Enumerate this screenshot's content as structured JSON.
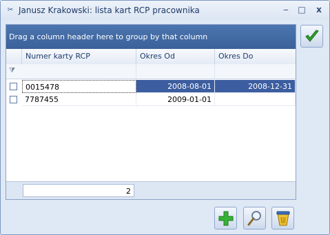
{
  "window": {
    "title": "Janusz Krakowski: lista kart RCP pracownika",
    "min_glyph": "‒",
    "max_glyph": "□",
    "close_glyph": "x"
  },
  "grid": {
    "group_panel_text": "Drag a column header here to group by that column",
    "columns": [
      "Numer karty RCP",
      "Okres Od",
      "Okres Do"
    ],
    "rows": [
      {
        "numer": "0015478",
        "od": "2008-08-01",
        "do": "2008-12-31",
        "selected": true
      },
      {
        "numer": "7787455",
        "od": "2009-01-01",
        "do": "",
        "selected": false
      }
    ],
    "footer_count": "2"
  },
  "buttons": {
    "ok": "check-icon",
    "add": "plus-icon",
    "preview": "magnifier-icon",
    "delete": "bin-icon"
  },
  "colors": {
    "accent": "#3b6199",
    "selection": "#3c5d9f",
    "ok_green": "#2ea12e",
    "add_green": "#36b336"
  }
}
